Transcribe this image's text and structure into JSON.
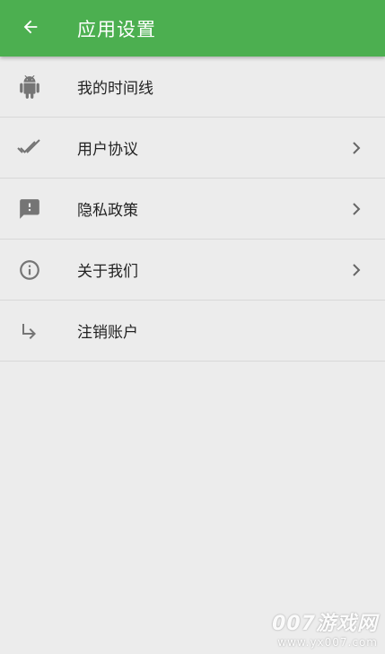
{
  "appbar": {
    "title": "应用设置",
    "back_icon": "arrow-left-icon",
    "color": "#4caf50"
  },
  "menu": [
    {
      "label": "我的时间线",
      "icon": "android-icon",
      "has_chevron": false
    },
    {
      "label": "用户协议",
      "icon": "double-check-icon",
      "has_chevron": true
    },
    {
      "label": "隐私政策",
      "icon": "feedback-icon",
      "has_chevron": true
    },
    {
      "label": "关于我们",
      "icon": "info-icon",
      "has_chevron": true
    },
    {
      "label": "注销账户",
      "icon": "subdirectory-arrow-icon",
      "has_chevron": false
    }
  ],
  "watermark": {
    "main": "007游戏网",
    "url": "www.yx007.com"
  }
}
